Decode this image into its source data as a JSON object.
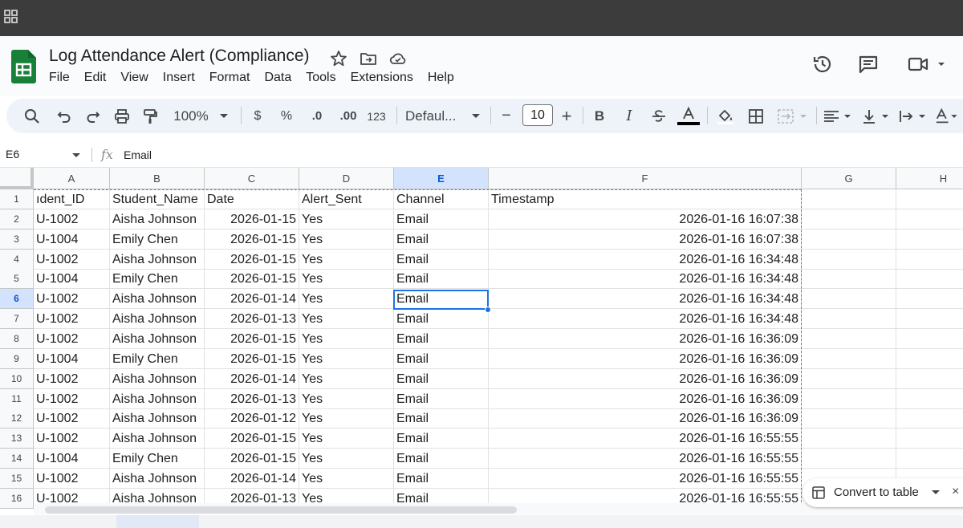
{
  "app": {
    "doc_title": "Log Attendance Alert (Compliance)",
    "menu": [
      "File",
      "Edit",
      "View",
      "Insert",
      "Format",
      "Data",
      "Tools",
      "Extensions",
      "Help"
    ]
  },
  "toolbar": {
    "zoom": "100%",
    "currency": "$",
    "percent": "%",
    "decrease_decimal": ".0",
    "increase_decimal": ".00",
    "number_format": "123",
    "font": "Defaul...",
    "font_size": "10",
    "minus": "−",
    "plus": "+",
    "bold": "B",
    "italic": "I"
  },
  "formula_bar": {
    "cell_ref": "E6",
    "fx": "fx",
    "content": "Email"
  },
  "columns": [
    "A",
    "B",
    "C",
    "D",
    "E",
    "F",
    "G",
    "H"
  ],
  "selected_column": "E",
  "selected_row": "6",
  "rows": [
    {
      "num": "1",
      "a": "ıdent_ID",
      "b": "Student_Name",
      "c": "Date",
      "d": "Alert_Sent",
      "e": "Channel",
      "f": "Timestamp"
    },
    {
      "num": "2",
      "a": "U-1002",
      "b": "Aisha Johnson",
      "c": "2026-01-15",
      "d": "Yes",
      "e": "Email",
      "f": "2026-01-16 16:07:38"
    },
    {
      "num": "3",
      "a": "U-1004",
      "b": "Emily Chen",
      "c": "2026-01-15",
      "d": "Yes",
      "e": "Email",
      "f": "2026-01-16 16:07:38"
    },
    {
      "num": "4",
      "a": "U-1002",
      "b": "Aisha Johnson",
      "c": "2026-01-15",
      "d": "Yes",
      "e": "Email",
      "f": "2026-01-16 16:34:48"
    },
    {
      "num": "5",
      "a": "U-1004",
      "b": "Emily Chen",
      "c": "2026-01-15",
      "d": "Yes",
      "e": "Email",
      "f": "2026-01-16 16:34:48"
    },
    {
      "num": "6",
      "a": "U-1002",
      "b": "Aisha Johnson",
      "c": "2026-01-14",
      "d": "Yes",
      "e": "Email",
      "f": "2026-01-16 16:34:48"
    },
    {
      "num": "7",
      "a": "U-1002",
      "b": "Aisha Johnson",
      "c": "2026-01-13",
      "d": "Yes",
      "e": "Email",
      "f": "2026-01-16 16:34:48"
    },
    {
      "num": "8",
      "a": "U-1002",
      "b": "Aisha Johnson",
      "c": "2026-01-15",
      "d": "Yes",
      "e": "Email",
      "f": "2026-01-16 16:36:09"
    },
    {
      "num": "9",
      "a": "U-1004",
      "b": "Emily Chen",
      "c": "2026-01-15",
      "d": "Yes",
      "e": "Email",
      "f": "2026-01-16 16:36:09"
    },
    {
      "num": "10",
      "a": "U-1002",
      "b": "Aisha Johnson",
      "c": "2026-01-14",
      "d": "Yes",
      "e": "Email",
      "f": "2026-01-16 16:36:09"
    },
    {
      "num": "11",
      "a": "U-1002",
      "b": "Aisha Johnson",
      "c": "2026-01-13",
      "d": "Yes",
      "e": "Email",
      "f": "2026-01-16 16:36:09"
    },
    {
      "num": "12",
      "a": "U-1002",
      "b": "Aisha Johnson",
      "c": "2026-01-12",
      "d": "Yes",
      "e": "Email",
      "f": "2026-01-16 16:36:09"
    },
    {
      "num": "13",
      "a": "U-1002",
      "b": "Aisha Johnson",
      "c": "2026-01-15",
      "d": "Yes",
      "e": "Email",
      "f": "2026-01-16 16:55:55"
    },
    {
      "num": "14",
      "a": "U-1004",
      "b": "Emily Chen",
      "c": "2026-01-15",
      "d": "Yes",
      "e": "Email",
      "f": "2026-01-16 16:55:55"
    },
    {
      "num": "15",
      "a": "U-1002",
      "b": "Aisha Johnson",
      "c": "2026-01-14",
      "d": "Yes",
      "e": "Email",
      "f": "2026-01-16 16:55:55"
    },
    {
      "num": "16",
      "a": "U-1002",
      "b": "Aisha Johnson",
      "c": "2026-01-13",
      "d": "Yes",
      "e": "Email",
      "f": "2026-01-16 16:55:55"
    }
  ],
  "convert_chip": {
    "label": "Convert to table",
    "close": "×"
  },
  "colors": {
    "accent": "#1a73e8",
    "sheets_green": "#188038",
    "selected_header": "#d3e3fd"
  }
}
